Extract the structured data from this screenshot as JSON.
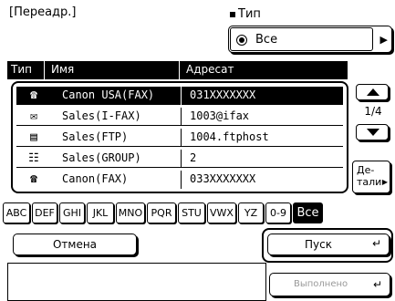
{
  "header": {
    "title": "[Переадр.]",
    "type_label": "Тип",
    "type_value": "Все"
  },
  "columns": [
    "Тип",
    "Имя",
    "Адресат"
  ],
  "rows": [
    {
      "icon": "fax-icon",
      "name": "Canon USA(FAX)",
      "address": "031XXXXXXX",
      "selected": true
    },
    {
      "icon": "ifax-icon",
      "name": "Sales(I-FAX)",
      "address": "1003@ifax",
      "selected": false
    },
    {
      "icon": "ftp-icon",
      "name": "Sales(FTP)",
      "address": "1004.ftphost",
      "selected": false
    },
    {
      "icon": "group-icon",
      "name": "Sales(GROUP)",
      "address": "2",
      "selected": false
    },
    {
      "icon": "fax-icon",
      "name": "Canon(FAX)",
      "address": "033XXXXXXX",
      "selected": false
    }
  ],
  "pagination": {
    "page": "1/4"
  },
  "details_label": "Де-\nтали",
  "alpha_keys": [
    "ABC",
    "DEF",
    "GHI",
    "JKL",
    "MNO",
    "PQR",
    "STU",
    "VWX",
    "YZ",
    "0-9",
    "Все"
  ],
  "buttons": {
    "cancel": "Отмена",
    "start": "Пуск",
    "execute": "Выполнено"
  }
}
